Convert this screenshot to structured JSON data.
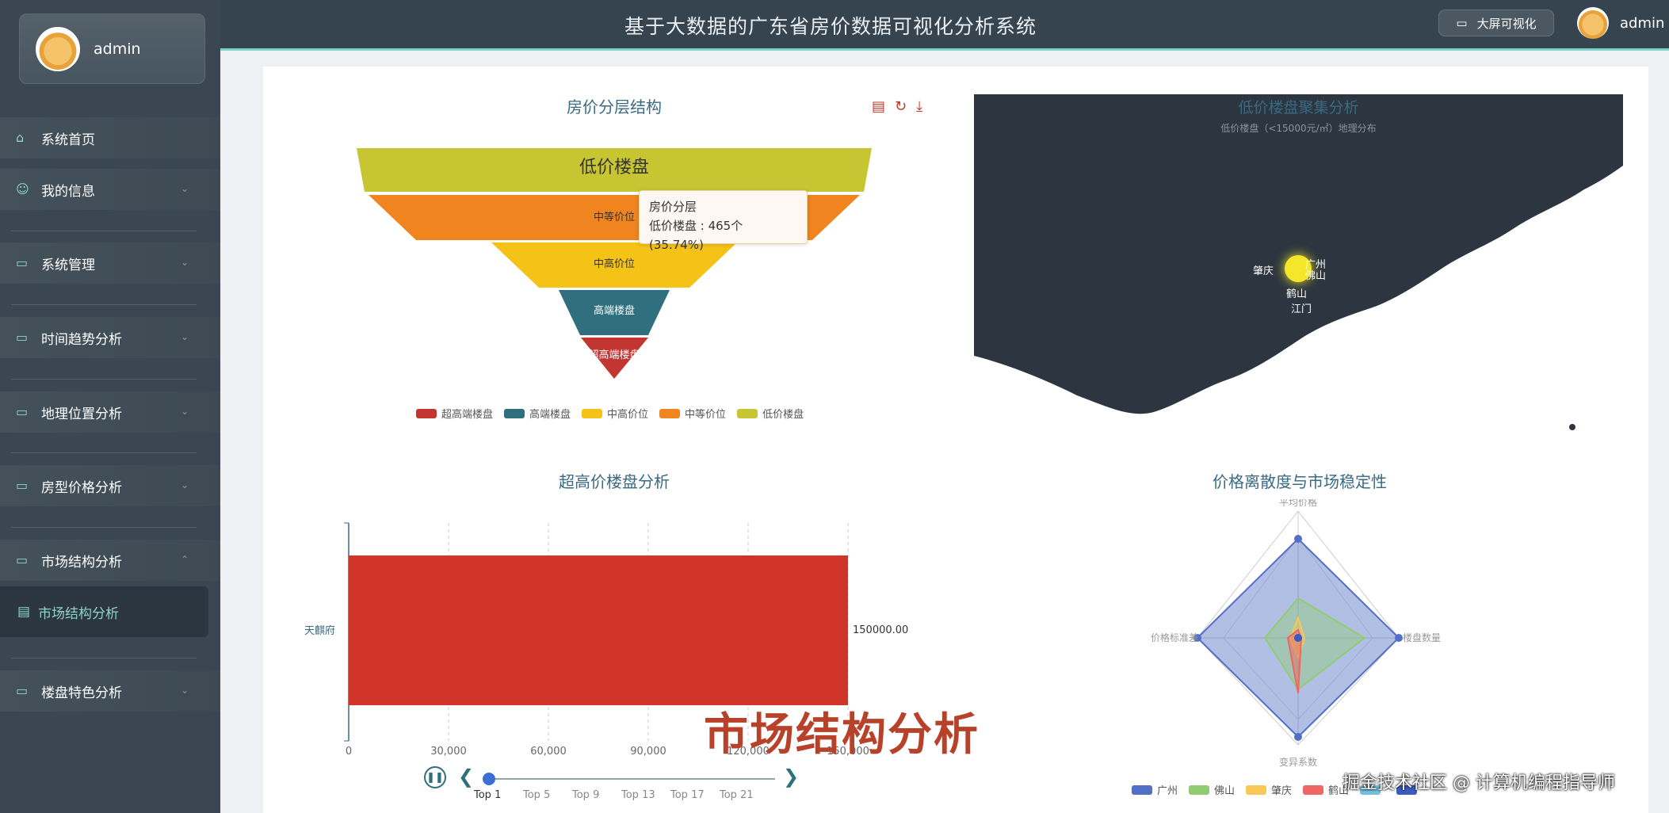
{
  "header": {
    "title": "基于大数据的广东省房价数据可视化分析系统",
    "big_screen_btn": "大屏可视化",
    "user": "admin"
  },
  "sidebar": {
    "user": "admin",
    "items": [
      {
        "label": "系统首页",
        "icon": "home-icon"
      },
      {
        "label": "我的信息",
        "icon": "user-icon"
      },
      {
        "label": "系统管理",
        "icon": "folder-icon"
      },
      {
        "label": "时间趋势分析",
        "icon": "folder-icon"
      },
      {
        "label": "地理位置分析",
        "icon": "folder-icon"
      },
      {
        "label": "房型价格分析",
        "icon": "folder-icon"
      },
      {
        "label": "市场结构分析",
        "icon": "folder-icon"
      },
      {
        "label": "楼盘特色分析",
        "icon": "folder-icon"
      }
    ],
    "sub_item": "市场结构分析"
  },
  "funnel": {
    "title": "房价分层结构",
    "tooltip_title": "房价分层",
    "tooltip_value": "低价楼盘 : 465个 (35.74%)",
    "legend": [
      "超高端楼盘",
      "高端楼盘",
      "中高价位",
      "中等价位",
      "低价楼盘"
    ],
    "colors": [
      "#c23531",
      "#2f6f7e",
      "#f5c317",
      "#f0851f",
      "#c7c532"
    ],
    "layers": [
      "低价楼盘",
      "中等价位",
      "中高价位",
      "高端楼盘",
      "超高端楼盘"
    ]
  },
  "map": {
    "title": "低价楼盘聚集分析",
    "subtitle": "低价楼盘（<15000元/㎡）地理分布",
    "cities": [
      "肇庆",
      "广州",
      "佛山",
      "鹤山",
      "江门"
    ]
  },
  "bar": {
    "title": "超高价楼盘分析",
    "category": "天麒府",
    "value_label": "150000.00",
    "ticks": [
      "0",
      "30,000",
      "60,000",
      "90,000",
      "120,000",
      "150,000"
    ],
    "timeline": [
      "Top 1",
      "Top 5",
      "Top 9",
      "Top 13",
      "Top 17",
      "Top 21"
    ]
  },
  "chart_data": [
    {
      "type": "funnel",
      "title": "房价分层结构",
      "categories": [
        "低价楼盘",
        "中等价位",
        "中高价位",
        "高端楼盘",
        "超高端楼盘"
      ],
      "values": [
        465
      ]
    },
    {
      "type": "bar",
      "title": "超高价楼盘分析",
      "categories": [
        "天麒府"
      ],
      "values": [
        150000
      ],
      "xlim": [
        0,
        150000
      ]
    },
    {
      "type": "radar",
      "title": "价格离散度与市场稳定性",
      "indicators": [
        "平均价格",
        "楼盘数量",
        "变异系数",
        "价格标准差"
      ],
      "series": [
        {
          "name": "广州"
        },
        {
          "name": "佛山"
        },
        {
          "name": "肇庆"
        },
        {
          "name": "鹤山"
        }
      ]
    }
  ],
  "radar": {
    "title": "价格离散度与市场稳定性",
    "indicators": [
      "平均价格",
      "楼盘数量",
      "变异系数",
      "价格标准差"
    ],
    "legend": [
      "广州",
      "佛山",
      "肇庆",
      "鹤山"
    ],
    "colors": [
      "#5470c6",
      "#91cc75",
      "#fac858",
      "#ee6666",
      "#73c0de",
      "#3b5bc0"
    ]
  },
  "overlay": {
    "watermark": "市场结构分析",
    "credit": "掘金技术社区 @ 计算机编程指导师"
  }
}
